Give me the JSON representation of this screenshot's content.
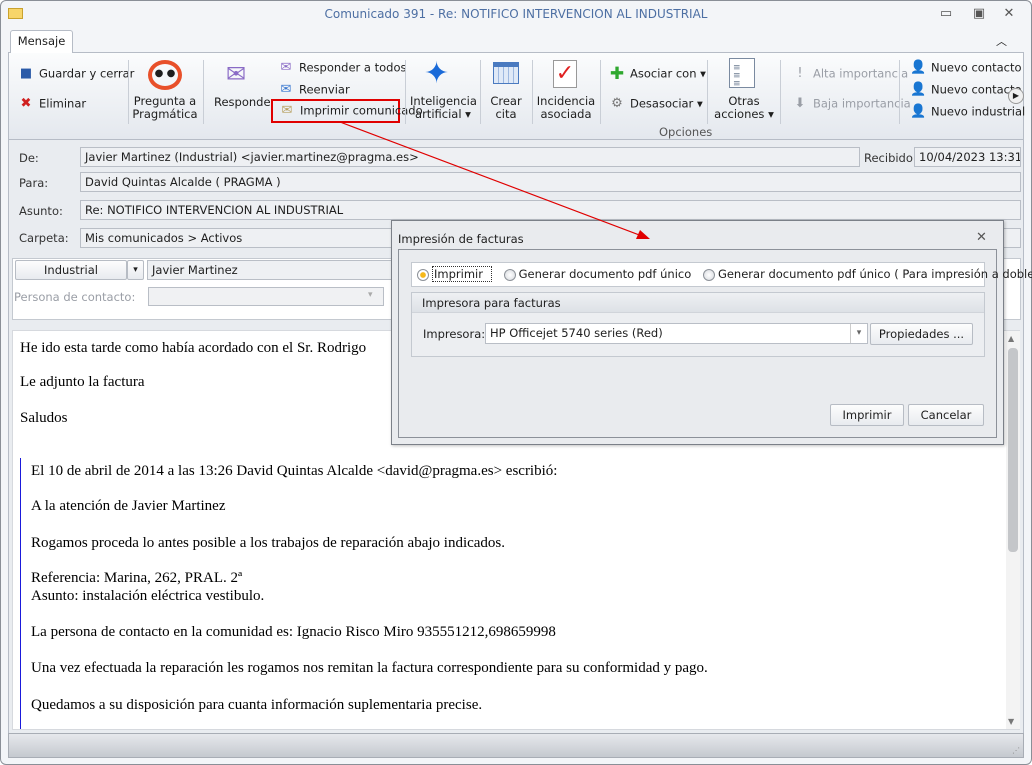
{
  "window": {
    "title": "Comunicado 391 - Re: NOTIFICO INTERVENCION AL INDUSTRIAL",
    "tab": "Mensaje"
  },
  "ribbon": {
    "guardar": "Guardar y cerrar",
    "eliminar": "Eliminar",
    "pregunta": [
      "Pregunta a",
      "Pragmática"
    ],
    "responder": "Responder",
    "responder_todos": "Responder a todos",
    "reenviar": "Reenviar",
    "imprimir": "Imprimir comunicado",
    "ia": [
      "Inteligencia",
      "artificial"
    ],
    "crear": [
      "Crear",
      "cita"
    ],
    "incidencia": [
      "Incidencia",
      "asociada"
    ],
    "asociar": "Asociar con",
    "desasociar": "Desasociar",
    "otras": [
      "Otras",
      "acciones"
    ],
    "alta": "Alta importancia",
    "baja": "Baja importancia",
    "group_label": "Opciones",
    "nuevo_contacto_1": "Nuevo contacto",
    "nuevo_contacto_2": "Nuevo contacto",
    "nuevo_industrial": "Nuevo industrial"
  },
  "header": {
    "de_label": "De:",
    "de": "Javier Martinez (Industrial) <javier.martinez@pragma.es>",
    "recibido_label": "Recibido:",
    "recibido": "10/04/2023 13:31",
    "para_label": "Para:",
    "para": "David Quintas Alcalde ( PRAGMA )",
    "asunto_label": "Asunto:",
    "asunto": "Re: NOTIFICO INTERVENCION AL INDUSTRIAL",
    "carpeta_label": "Carpeta:",
    "carpeta": "Mis comunicados > Activos",
    "tipo": "Industrial",
    "nombre": "Javier Martinez",
    "persona_label": "Persona de contacto:",
    "persona": ""
  },
  "body": {
    "lines": [
      "He ido esta tarde como había acordado con el Sr. Rodrigo",
      "Le adjunto la factura",
      "Saludos"
    ],
    "quote": [
      "El 10 de abril de 2014 a las 13:26 David Quintas Alcalde <david@pragma.es> escribió:",
      "A la atención de Javier Martinez",
      "Rogamos proceda lo antes posible a los trabajos de reparación abajo indicados.",
      "Referencia: Marina, 262, PRAL. 2ª",
      "Asunto: instalación eléctrica vestibulo.",
      "La persona de contacto en la comunidad es: Ignacio Risco Miro 935551212,698659998",
      "Una vez efectuada la reparación les rogamos nos remitan la factura correspondiente para su conformidad y pago.",
      "Quedamos a su disposición para cuanta información suplementaria precise."
    ]
  },
  "dialog": {
    "title": "Impresión de facturas",
    "options": [
      "Imprimir",
      "Generar documento pdf único",
      "Generar documento pdf único ( Para impresión a doble cara )"
    ],
    "selected": "Imprimir",
    "group": "Impresora para facturas",
    "printer_label": "Impresora:",
    "printer": "HP Officejet 5740 series (Red)",
    "properties": "Propiedades ...",
    "ok": "Imprimir",
    "cancel": "Cancelar"
  },
  "colors": {
    "highlight": "#e00000",
    "accent": "#4d6fa3",
    "quote_bar": "#1a1adb"
  }
}
